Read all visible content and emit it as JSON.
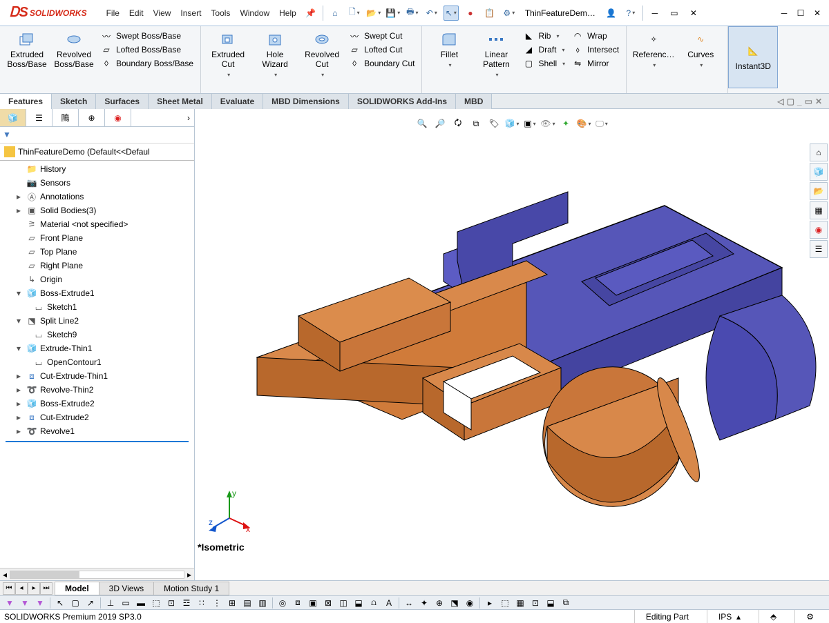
{
  "app": {
    "name": "SOLIDWORKS",
    "doc": "ThinFeatureDem…"
  },
  "menu": {
    "file": "File",
    "edit": "Edit",
    "view": "View",
    "insert": "Insert",
    "tools": "Tools",
    "window": "Window",
    "help": "Help"
  },
  "ribbon": {
    "extruded": "Extruded Boss/Base",
    "revolved": "Revolved Boss/Base",
    "swept": "Swept Boss/Base",
    "lofted": "Lofted Boss/Base",
    "boundary": "Boundary Boss/Base",
    "extrudedcut": "Extruded Cut",
    "hole": "Hole Wizard",
    "revolvedcut": "Revolved Cut",
    "sweptcut": "Swept Cut",
    "loftedcut": "Lofted Cut",
    "boundarycut": "Boundary Cut",
    "fillet": "Fillet",
    "linpat": "Linear Pattern",
    "rib": "Rib",
    "draft": "Draft",
    "shell": "Shell",
    "wrap": "Wrap",
    "intersect": "Intersect",
    "mirror": "Mirror",
    "refgeo": "Referenc…",
    "curves": "Curves",
    "instant3d": "Instant3D"
  },
  "tabs": {
    "features": "Features",
    "sketch": "Sketch",
    "surfaces": "Surfaces",
    "sheetmetal": "Sheet Metal",
    "evaluate": "Evaluate",
    "mbd": "MBD Dimensions",
    "addins": "SOLIDWORKS Add-Ins",
    "mbd2": "MBD"
  },
  "tree": {
    "root": "ThinFeatureDemo  (Default<<Defaul",
    "items": [
      {
        "l": "History",
        "i": "folder"
      },
      {
        "l": "Sensors",
        "i": "sensor"
      },
      {
        "l": "Annotations",
        "i": "ann",
        "exp": true
      },
      {
        "l": "Solid Bodies(3)",
        "i": "solid",
        "exp": true
      },
      {
        "l": "Material <not specified>",
        "i": "mat"
      },
      {
        "l": "Front Plane",
        "i": "plane"
      },
      {
        "l": "Top Plane",
        "i": "plane"
      },
      {
        "l": "Right Plane",
        "i": "plane"
      },
      {
        "l": "Origin",
        "i": "origin"
      },
      {
        "l": "Boss-Extrude1",
        "i": "feat",
        "exp": true,
        "open": true,
        "child": "Sketch1"
      },
      {
        "l": "Split Line2",
        "i": "split",
        "exp": true,
        "open": true,
        "child": "Sketch9"
      },
      {
        "l": "Extrude-Thin1",
        "i": "feat",
        "exp": true,
        "open": true,
        "child": "OpenContour1"
      },
      {
        "l": "Cut-Extrude-Thin1",
        "i": "cut",
        "exp": true
      },
      {
        "l": "Revolve-Thin2",
        "i": "rev",
        "exp": true
      },
      {
        "l": "Boss-Extrude2",
        "i": "feat",
        "exp": true
      },
      {
        "l": "Cut-Extrude2",
        "i": "cut",
        "exp": true
      },
      {
        "l": "Revolve1",
        "i": "rev",
        "exp": true
      }
    ]
  },
  "mdltabs": {
    "model": "Model",
    "views3d": "3D Views",
    "motion": "Motion Study 1"
  },
  "view": {
    "label": "*Isometric",
    "axes": {
      "x": "x",
      "y": "y",
      "z": "z"
    }
  },
  "status": {
    "left": "SOLIDWORKS Premium 2019 SP3.0",
    "edit": "Editing Part",
    "ips": "IPS"
  }
}
